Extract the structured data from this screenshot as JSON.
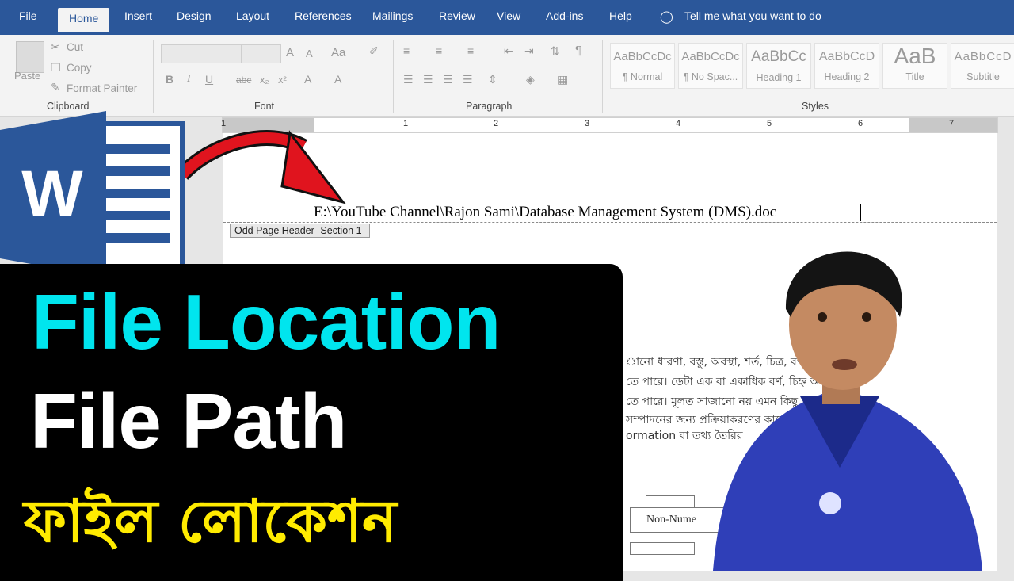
{
  "ribbon": {
    "tabs": [
      "File",
      "Home",
      "Insert",
      "Design",
      "Layout",
      "References",
      "Mailings",
      "Review",
      "View",
      "Add-ins",
      "Help"
    ],
    "tell_me": "Tell me what you want to do",
    "clipboard": {
      "paste": "Paste",
      "cut": "Cut",
      "copy": "Copy",
      "format_painter": "Format Painter",
      "label": "Clipboard"
    },
    "font": {
      "label": "Font",
      "bold": "B",
      "italic": "I",
      "underline": "U",
      "strike": "abc",
      "grow": "A",
      "shrink": "A",
      "case": "Aa"
    },
    "paragraph": {
      "label": "Paragraph",
      "pilcrow": "¶"
    },
    "styles": {
      "label": "Styles",
      "items": [
        {
          "preview": "AaBbCcDc",
          "name": "¶ Normal"
        },
        {
          "preview": "AaBbCcDc",
          "name": "¶ No Spac..."
        },
        {
          "preview": "AaBbCc",
          "name": "Heading 1"
        },
        {
          "preview": "AaBbCcD",
          "name": "Heading 2"
        },
        {
          "preview": "AaB",
          "name": "Title"
        },
        {
          "preview": "AaBbCcD",
          "name": "Subtitle"
        }
      ]
    }
  },
  "ruler": {
    "numbers": [
      "1",
      "1",
      "2",
      "3",
      "4",
      "5",
      "6",
      "7"
    ]
  },
  "document": {
    "header_path": "E:\\YouTube Channel\\Rajon Sami\\Database Management System (DMS).doc",
    "header_tag": "Odd Page Header -Section 1-",
    "body_lines": [
      "ানো ধারণা, বস্তু, অবস্থা, শর্ত, চিত্র, বর্ণনা",
      "তে পারে। ডেটা এক বা একাধিক বর্ণ, চিহ্ন অ",
      "তে পারে। মূলত সাজানো নয় এমন কিছু",
      "সম্পাদনের জন্য প্রক্রিয়াকরণের কাজে",
      "ormation বা তথ্য তৈরির"
    ],
    "flow_box": "Non-Nume"
  },
  "overlay": {
    "line1": "File Location",
    "line2": "File Path",
    "line3": "ফাইল লোকেশন"
  },
  "colors": {
    "word_blue": "#2b579a",
    "cyan": "#00e5ee",
    "yellow": "#ffeb00",
    "arrow_red": "#e0141e"
  }
}
